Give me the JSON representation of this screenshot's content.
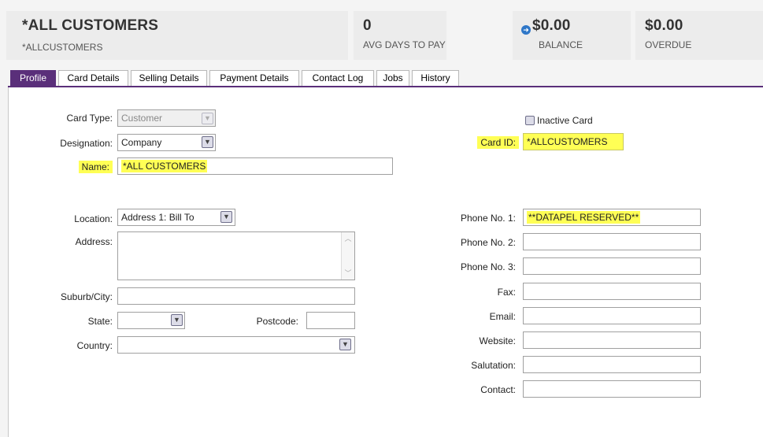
{
  "header": {
    "card_name": "*ALL CUSTOMERS",
    "card_id": "*ALLCUSTOMERS",
    "avg_days": "0",
    "avg_days_label": "AVG DAYS TO PAY",
    "balance": "$0.00",
    "balance_label": "BALANCE",
    "overdue": "$0.00",
    "overdue_label": "OVERDUE"
  },
  "tabs": [
    {
      "label": "Profile",
      "active": true
    },
    {
      "label": "Card Details"
    },
    {
      "label": "Selling Details"
    },
    {
      "label": "Payment Details"
    },
    {
      "label": "Contact Log"
    },
    {
      "label": "Jobs"
    },
    {
      "label": "History"
    }
  ],
  "form": {
    "card_type_label": "Card Type:",
    "card_type_value": "Customer",
    "designation_label": "Designation:",
    "designation_value": "Company",
    "name_label": "Name:",
    "name_value": "*ALL CUSTOMERS",
    "inactive_label": "Inactive Card",
    "card_id_label": "Card ID:",
    "card_id_value": "*ALLCUSTOMERS",
    "location_label": "Location:",
    "location_value": "Address 1: Bill To",
    "address_label": "Address:",
    "address_value": "",
    "suburb_label": "Suburb/City:",
    "suburb_value": "",
    "state_label": "State:",
    "state_value": "",
    "postcode_label": "Postcode:",
    "postcode_value": "",
    "country_label": "Country:",
    "country_value": "",
    "phone1_label": "Phone No. 1:",
    "phone1_value": "**DATAPEL RESERVED**",
    "phone2_label": "Phone No. 2:",
    "phone2_value": "",
    "phone3_label": "Phone No. 3:",
    "phone3_value": "",
    "fax_label": "Fax:",
    "fax_value": "",
    "email_label": "Email:",
    "email_value": "",
    "website_label": "Website:",
    "website_value": "",
    "salutation_label": "Salutation:",
    "salutation_value": "",
    "contact_label": "Contact:",
    "contact_value": ""
  },
  "colors": {
    "accent": "#5a2f7a",
    "highlight": "#ffff55",
    "balance_icon": "#2f77c8"
  },
  "icons": {
    "dropdown": "chevron-down-icon",
    "balance": "arrow-right-circle-icon"
  }
}
